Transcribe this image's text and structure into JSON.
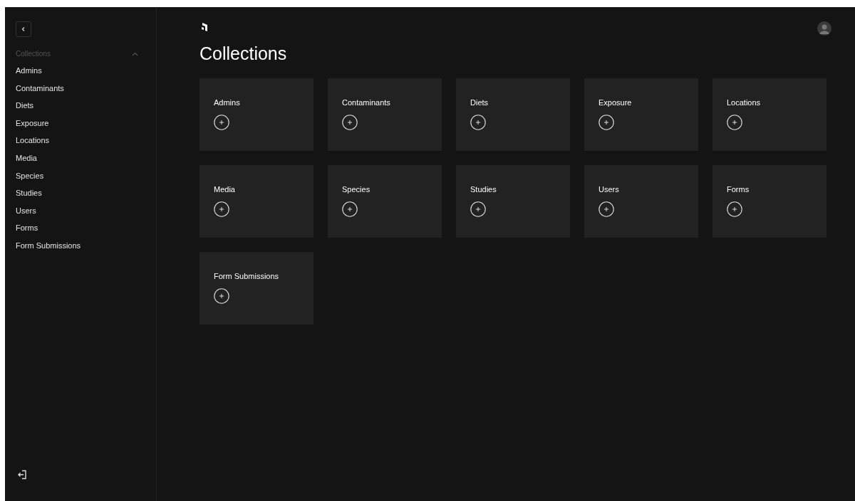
{
  "sidebar": {
    "group": {
      "label": "Collections",
      "expanded": true,
      "items": [
        {
          "label": "Admins"
        },
        {
          "label": "Contaminants"
        },
        {
          "label": "Diets"
        },
        {
          "label": "Exposure"
        },
        {
          "label": "Locations"
        },
        {
          "label": "Media"
        },
        {
          "label": "Species"
        },
        {
          "label": "Studies"
        },
        {
          "label": "Users"
        },
        {
          "label": "Forms"
        },
        {
          "label": "Form Submissions"
        }
      ]
    }
  },
  "main": {
    "title": "Collections",
    "cards": [
      {
        "label": "Admins"
      },
      {
        "label": "Contaminants"
      },
      {
        "label": "Diets"
      },
      {
        "label": "Exposure"
      },
      {
        "label": "Locations"
      },
      {
        "label": "Media"
      },
      {
        "label": "Species"
      },
      {
        "label": "Studies"
      },
      {
        "label": "Users"
      },
      {
        "label": "Forms"
      },
      {
        "label": "Form Submissions"
      }
    ]
  }
}
